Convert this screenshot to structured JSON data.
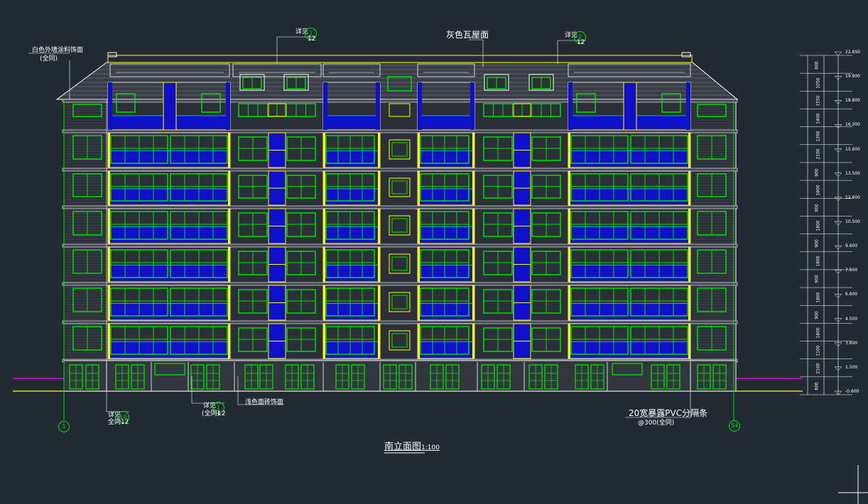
{
  "drawing": {
    "title": "南立面图",
    "scale": "1:100",
    "roof_note": "灰色瓦屋面",
    "eave_note": "白色外墙涂料饰面",
    "eave_note_sub": "(全同)",
    "base_note": "浅色面砖饰面",
    "pvc_note": "20宽暴露PVC分隔条",
    "pvc_note_sub": "@300(全同)",
    "detail_left_a": "详见",
    "detail_left_a_num": "10",
    "detail_left_a_ref": "12",
    "detail_left_a_sub": "全同",
    "detail_left_b": "详见",
    "detail_left_b_num": "1",
    "detail_left_b_ref": "12",
    "detail_left_b_sub": "(全同)",
    "detail_top_a": "详见",
    "detail_top_a_num": "2",
    "detail_top_a_ref": "12",
    "detail_top_b": "详见",
    "detail_top_b_num": "2",
    "detail_top_b_ref": "12",
    "axis_left": "1",
    "axis_right": "54"
  },
  "elevations": [
    "22.850",
    "19.800",
    "18.800",
    "16.300",
    "15.600",
    "13.500",
    "12.600",
    "10.500",
    "9.600",
    "7.500",
    "6.600",
    "4.500",
    "3.600",
    "1.500",
    "-0.600"
  ],
  "dimensions": [
    "600",
    "1050",
    "1550",
    "1400",
    "1200",
    "2100",
    "900",
    "1800",
    "900",
    "1800",
    "900",
    "1800",
    "900",
    "1800",
    "900",
    "1800",
    "1100",
    "2100",
    "600"
  ],
  "colors": {
    "background": "#222a33",
    "outline": "#ffffff",
    "window": "#00e000",
    "glass_panel": "#1010c8",
    "trim": "#ffff00",
    "balcony_rail": "#00b0e0",
    "magenta_ground": "#ff00ff"
  }
}
